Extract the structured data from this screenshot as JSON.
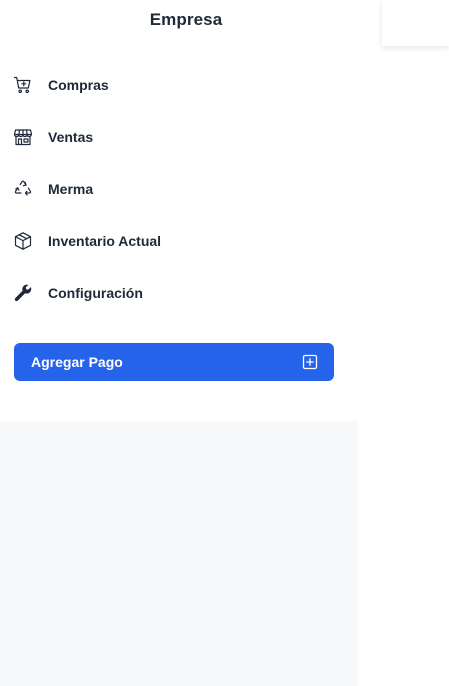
{
  "sidebar": {
    "title": "Empresa",
    "items": [
      {
        "label": "Compras",
        "icon": "shopping-cart-plus-icon"
      },
      {
        "label": "Ventas",
        "icon": "storefront-icon"
      },
      {
        "label": "Merma",
        "icon": "recycle-icon"
      },
      {
        "label": "Inventario Actual",
        "icon": "box-icon"
      },
      {
        "label": "Configuración",
        "icon": "wrench-icon"
      }
    ],
    "add_payment_label": "Agregar Pago",
    "add_payment_icon": "plus-square-icon"
  },
  "colors": {
    "accent": "#2563eb",
    "text": "#1f2937",
    "footer_bg": "#f8f9fb"
  }
}
